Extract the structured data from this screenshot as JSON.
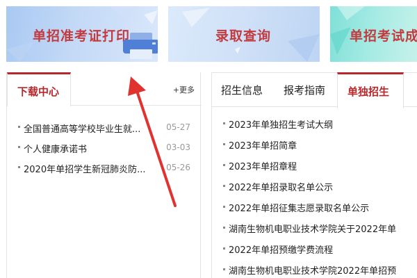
{
  "banners": [
    {
      "label": "单招准考证打印"
    },
    {
      "label": "录取查询"
    },
    {
      "label": "单招考试成"
    }
  ],
  "downloads": {
    "title": "下载中心",
    "more": "+更多",
    "items": [
      {
        "title": "全国普通高等学校毕业生就...",
        "date": "05-27"
      },
      {
        "title": "个人健康承诺书",
        "date": "03-03"
      },
      {
        "title": "2020年单招学生新冠肺炎防...",
        "date": "05-26"
      }
    ]
  },
  "admissions": {
    "tabs": [
      "招生信息",
      "报考指南",
      "单独招生"
    ],
    "items": [
      "2023年单独招生考试大纲",
      "2023年单招简章",
      "2023年单招章程",
      "2022年单招录取名单公示",
      "2022年单招征集志愿录取名单公示",
      "湖南生物机电职业技术学院关于2022年单",
      "2022年单招预缴学费流程",
      "湖南生物机电职业技术学院2022年单招预"
    ]
  },
  "colors": {
    "accent": "#b8272c",
    "banner_text": "#c23a3e",
    "arrow": "#e0322f"
  }
}
